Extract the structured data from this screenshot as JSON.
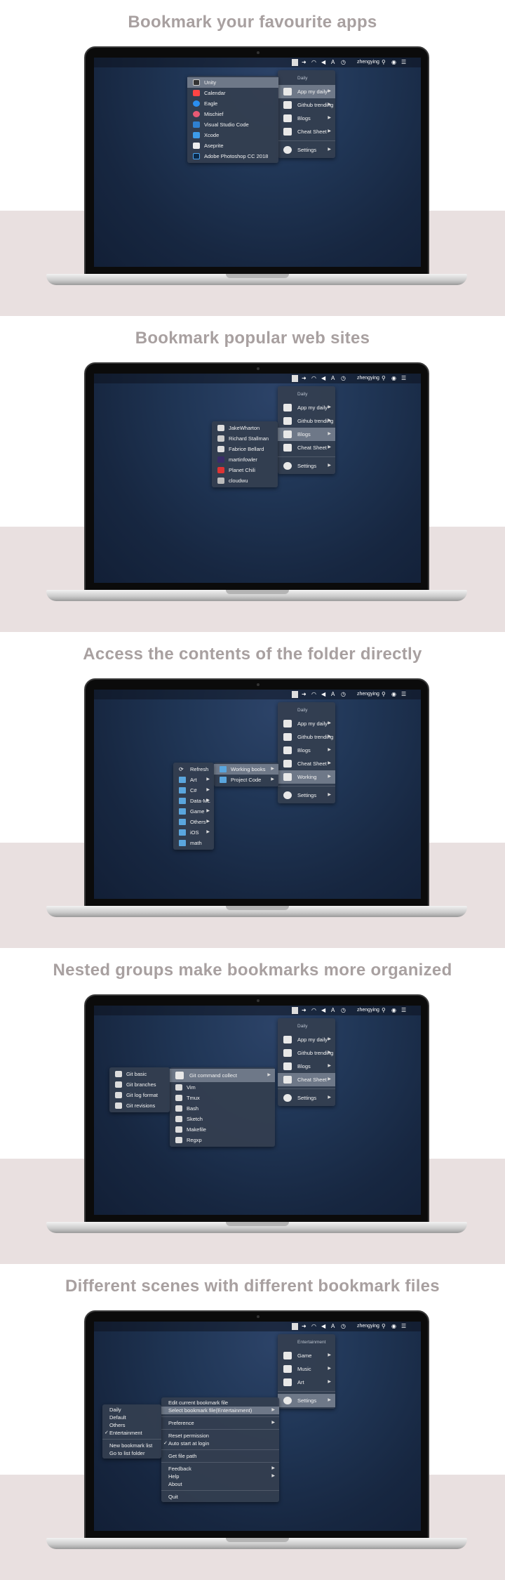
{
  "menubar": {
    "user": "zhengying"
  },
  "sections": [
    {
      "title": "Bookmark your favourite apps",
      "group": "Daily",
      "main_items": [
        "App my daily",
        "Github trending",
        "Blogs",
        "Cheat Sheet"
      ],
      "settings": "Settings",
      "sub_items": [
        "Unity",
        "Calendar",
        "Eagle",
        "Mischief",
        "Visual Studio Code",
        "Xcode",
        "Aseprite",
        "Adobe Photoshop CC 2018"
      ]
    },
    {
      "title": "Bookmark popular web sites",
      "group": "Daily",
      "main_items": [
        "App my daily",
        "Github trending",
        "Blogs",
        "Cheat Sheet"
      ],
      "settings": "Settings",
      "sub_items": [
        "JakeWharton",
        "Richard Stallman",
        "Fabrice Bellard",
        "martinfowler",
        "Planet Chili",
        "cloudwu"
      ]
    },
    {
      "title": "Access the contents of the folder directly",
      "group": "Daily",
      "main_items": [
        "App my daily",
        "Github trending",
        "Blogs",
        "Cheat Sheet",
        "Working"
      ],
      "settings": "Settings",
      "sub_items": [
        "Working books",
        "Project Code"
      ],
      "folder_items": [
        "Refresh",
        "Art",
        "C#",
        "Data-ML",
        "Game",
        "Others",
        "iOS",
        "math"
      ]
    },
    {
      "title": "Nested groups make bookmarks more organized",
      "group": "Daily",
      "main_items": [
        "App my daily",
        "Github trending",
        "Blogs",
        "Cheat Sheet"
      ],
      "settings": "Settings",
      "sub_items": [
        "Git command collect",
        "Vim",
        "Tmux",
        "Bash",
        "Sketch",
        "Makefile",
        "Regxp"
      ],
      "nested_items": [
        "Git basic",
        "Git branches",
        "Git log format",
        "Git revisions"
      ]
    },
    {
      "title": "Different scenes with different bookmark files",
      "group": "Entertainment",
      "main_items": [
        "Game",
        "Music",
        "Art"
      ],
      "settings": "Settings",
      "settings_items": [
        "Edit current bookmark file",
        "Select bookmark file(Entertainment)",
        "Preference",
        "Reset permission",
        "Auto start at login",
        "Get file path",
        "Feedback",
        "Help",
        "About",
        "Quit"
      ],
      "files_items": [
        "Daily",
        "Default",
        "Others",
        "Entertainment",
        "New bookmark list",
        "Go to list folder"
      ]
    }
  ]
}
